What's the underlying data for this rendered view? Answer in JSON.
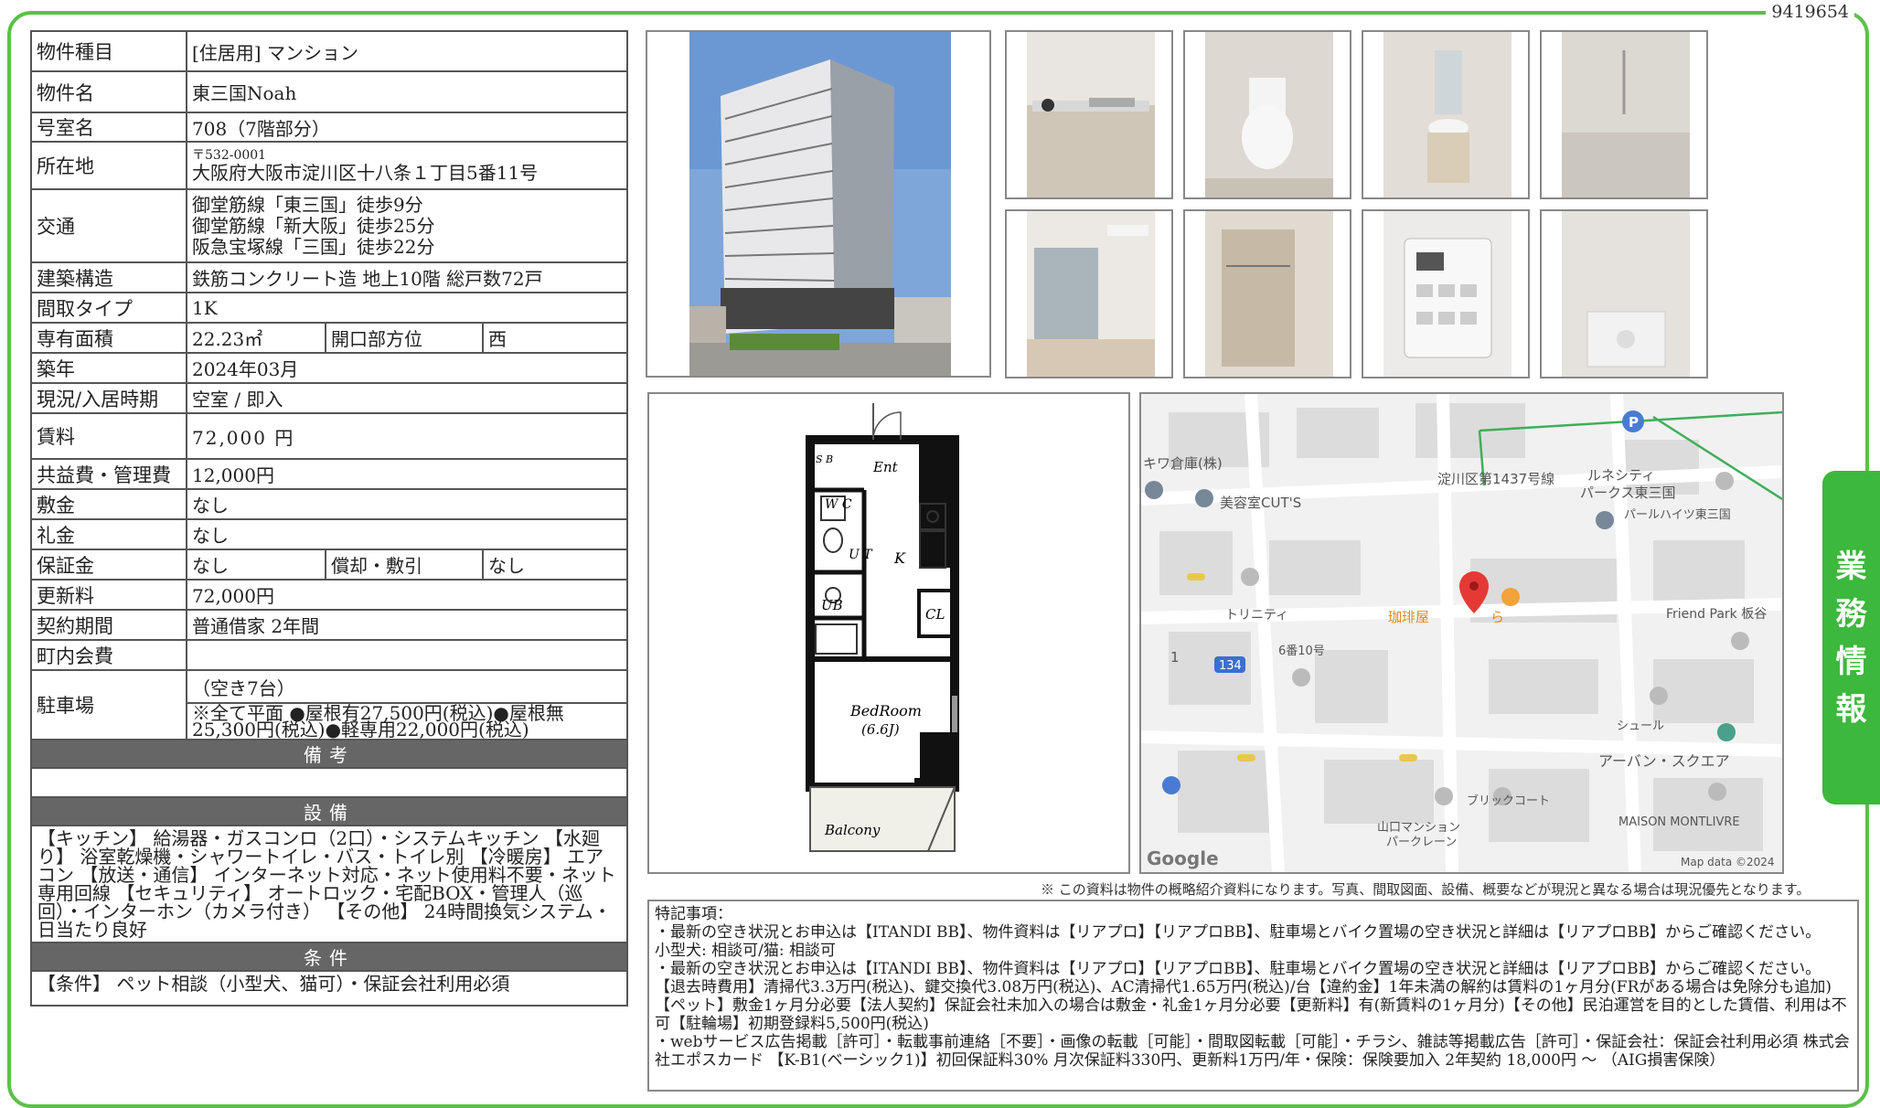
{
  "doc_id": "9419654",
  "side_tab": [
    "業",
    "務",
    "情",
    "報"
  ],
  "property": {
    "type_label": "物件種目",
    "type_value": "[住居用] マンション",
    "name_label": "物件名",
    "name_value": "東三国Noah",
    "room_label": "号室名",
    "room_value": "708（7階部分）",
    "address_label": "所在地",
    "postal": "〒532-0001",
    "address": "大阪府大阪市淀川区十八条１丁目5番11号",
    "transport_label": "交通",
    "transport": [
      "御堂筋線「東三国」徒歩9分",
      "御堂筋線「新大阪」徒歩25分",
      "阪急宝塚線「三国」徒歩22分"
    ],
    "structure_label": "建築構造",
    "structure_value": "鉄筋コンクリート造 地上10階 総戸数72戸",
    "layout_label": "間取タイプ",
    "layout_value": "1K",
    "area_label": "専有面積",
    "area_value": "22.23㎡",
    "direction_label": "開口部方位",
    "direction_value": "西",
    "built_label": "築年",
    "built_value": "2024年03月",
    "status_label": "現況/入居時期",
    "status_value": "空室 / 即入",
    "rent_label": "賃料",
    "rent_value": "72,000 円",
    "fee_label": "共益費・管理費",
    "fee_value": "12,000円",
    "deposit_label": "敷金",
    "deposit_value": "なし",
    "key_label": "礼金",
    "key_value": "なし",
    "guarantee_label": "保証金",
    "guarantee_value": "なし",
    "amort_label": "償却・敷引",
    "amort_value": "なし",
    "renewal_label": "更新料",
    "renewal_value": "72,000円",
    "contract_label": "契約期間",
    "contract_value": "普通借家 2年間",
    "town_label": "町内会費",
    "town_value": "",
    "parking_label": "駐車場",
    "parking_value": "（空き7台）",
    "parking_detail": "※全て平面 ●屋根有27,500円(税込)●屋根無25,300円(税込)●軽専用22,000円(税込)"
  },
  "remarks_head": "備考",
  "remarks_body": "",
  "equipment_head": "設備",
  "equipment_body": "【キッチン】 給湯器・ガスコンロ（2口）・システムキッチン 【水廻り】 浴室乾燥機・シャワートイレ・バス・トイレ別 【冷暖房】 エアコン 【放送・通信】 インターネット対応・ネット使用料不要・ネット専用回線 【セキュリティ】 オートロック・宅配BOX・管理人（巡回）・インターホン（カメラ付き） 【その他】 24時間換気システム・日当たり良好",
  "conditions_head": "条件",
  "conditions_body": "【条件】 ペット相談（小型犬、猫可）・保証会社利用必須",
  "floorplan": {
    "sb": "S B",
    "ent": "Ent",
    "wc": "W C",
    "ut": "U T",
    "k": "K",
    "ub": "UB",
    "cl": "CL",
    "bedroom": "BedRoom",
    "bedroom_size": "(6.6J)",
    "balcony": "Balcony"
  },
  "map": {
    "labels": {
      "kiwa": "キワ倉庫(株)",
      "cuts": "美容室CUT'S",
      "road": "淀川区第1437号線",
      "lunesity": "ルネシティ",
      "parks": "パークス東三国",
      "pearl": "パールハイツ東三国",
      "trinity": "トリニティ",
      "coffee": "珈琲屋",
      "coffee2": "ら",
      "friend": "Friend Park 板谷",
      "one": "1",
      "r134": "134",
      "block": "6番10号",
      "shool": "シュール",
      "urban": "アーバン・スクエア",
      "brick": "ブリックコート",
      "yama": "山口マンション",
      "yama2": "パークレーン",
      "montlivre": "MAISON MONTLIVRE",
      "google": "Google",
      "mapdata": "Map data ©2024"
    }
  },
  "disclaimer": "※ この資料は物件の概略紹介資料になります。写真、間取図面、設備、概要などが現況と異なる場合は現況優先となります。",
  "special": [
    "特記事項：",
    "・最新の空き状況とお申込は【ITANDI BB】、物件資料は【リアプロ】【リアプロBB】、駐車場とバイク置場の空き状況と詳細は【リアプロBB】からご確認ください。",
    "小型犬: 相談可/猫: 相談可",
    "・最新の空き状況とお申込は【ITANDI BB】、物件資料は【リアプロ】【リアプロBB】、駐車場とバイク置場の空き状況と詳細は【リアプロBB】からご確認ください。 【退去時費用】清掃代3.3万円(税込)、鍵交換代3.08万円(税込)、AC清掃代1.65万円(税込)/台【違約金】1年未満の解約は賃料の1ヶ月分(FRがある場合は免除分も追加) 【ペット】敷金1ヶ月分必要【法人契約】保証会社未加入の場合は敷金・礼金1ヶ月分必要【更新料】有(新賃料の1ヶ月分)【その他】民泊運営を目的とした賃借、利用は不可【駐輪場】初期登録料5,500円(税込)",
    "・webサービス広告掲載［許可］・転載事前連絡［不要］・画像の転載［可能］・間取図転載［可能］・チラシ、雑誌等掲載広告［許可］・保証会社：保証会社利用必須 株式会社エポスカード 【K-B1(ベーシック1)】初回保証料30% 月次保証料330円、更新料1万円/年・保険：保険要加入 2年契約 18,000円 〜 （AIG損害保険）"
  ],
  "colors": {
    "frame": "#5cc04a",
    "tab": "#3cb83c",
    "section_head": "#666666",
    "map_pin": "#e53935",
    "map_road": "#3fae5c"
  }
}
